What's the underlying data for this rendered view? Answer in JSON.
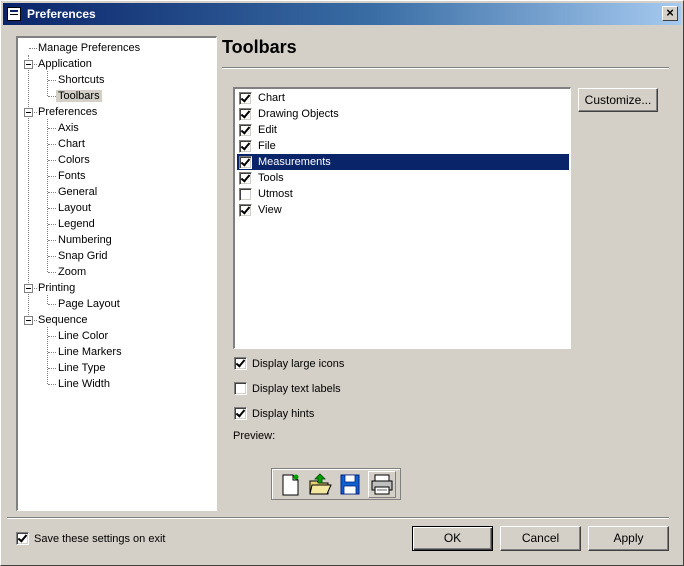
{
  "window": {
    "title": "Preferences",
    "close_label": "×"
  },
  "tree": {
    "items": [
      {
        "label": "Manage Preferences",
        "level": 0,
        "expander": false
      },
      {
        "label": "Application",
        "level": 0,
        "expander": true
      },
      {
        "label": "Shortcuts",
        "level": 1
      },
      {
        "label": "Toolbars",
        "level": 1,
        "selected": true
      },
      {
        "label": "Preferences",
        "level": 0,
        "expander": true
      },
      {
        "label": "Axis",
        "level": 1
      },
      {
        "label": "Chart",
        "level": 1
      },
      {
        "label": "Colors",
        "level": 1
      },
      {
        "label": "Fonts",
        "level": 1
      },
      {
        "label": "General",
        "level": 1
      },
      {
        "label": "Layout",
        "level": 1
      },
      {
        "label": "Legend",
        "level": 1
      },
      {
        "label": "Numbering",
        "level": 1
      },
      {
        "label": "Snap Grid",
        "level": 1
      },
      {
        "label": "Zoom",
        "level": 1
      },
      {
        "label": "Printing",
        "level": 0,
        "expander": true
      },
      {
        "label": "Page Layout",
        "level": 1
      },
      {
        "label": "Sequence",
        "level": 0,
        "expander": true
      },
      {
        "label": "Line Color",
        "level": 1
      },
      {
        "label": "Line Markers",
        "level": 1
      },
      {
        "label": "Line Type",
        "level": 1
      },
      {
        "label": "Line Width",
        "level": 1
      }
    ]
  },
  "panel": {
    "heading": "Toolbars"
  },
  "toolbars": [
    {
      "label": "Chart",
      "checked": true
    },
    {
      "label": "Drawing Objects",
      "checked": true
    },
    {
      "label": "Edit",
      "checked": true
    },
    {
      "label": "File",
      "checked": true
    },
    {
      "label": "Measurements",
      "checked": true,
      "selected": true
    },
    {
      "label": "Tools",
      "checked": true
    },
    {
      "label": "Utmost",
      "checked": false
    },
    {
      "label": "View",
      "checked": true
    }
  ],
  "buttons": {
    "customize": "Customize...",
    "ok": "OK",
    "cancel": "Cancel",
    "apply": "Apply"
  },
  "options": {
    "large_icons": {
      "label": "Display large icons",
      "checked": true
    },
    "text_labels": {
      "label": "Display text labels",
      "checked": false
    },
    "hints": {
      "label": "Display hints",
      "checked": true
    }
  },
  "preview": {
    "label": "Preview:",
    "icons": [
      "new-document-icon",
      "open-folder-icon",
      "save-disk-icon",
      "print-icon"
    ]
  },
  "footer": {
    "save_label": "Save these settings on exit",
    "save_checked": true
  }
}
